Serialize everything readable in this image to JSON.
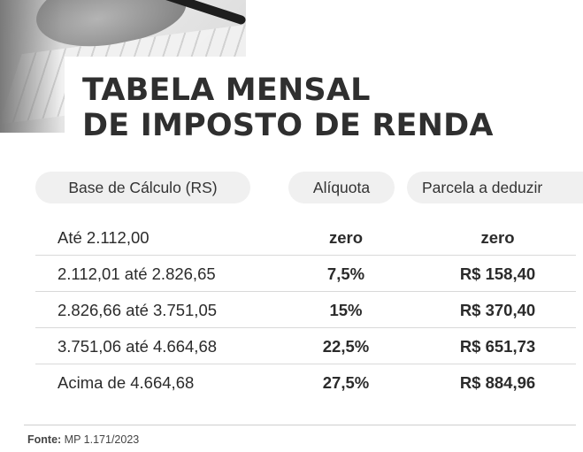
{
  "title": {
    "line1": "TABELA MENSAL",
    "line2": "DE IMPOSTO DE RENDA"
  },
  "table": {
    "headers": [
      "Base de Cálculo (RS)",
      "Alíquota",
      "Parcela a deduzir"
    ],
    "rows": [
      {
        "base": "Até 2.112,00",
        "aliquota": "zero",
        "parcela": "zero"
      },
      {
        "base": "2.112,01 até 2.826,65",
        "aliquota": "7,5%",
        "parcela": "R$ 158,40"
      },
      {
        "base": "2.826,66 até 3.751,05",
        "aliquota": "15%",
        "parcela": "R$ 370,40"
      },
      {
        "base": "3.751,06 até 4.664,68",
        "aliquota": "22,5%",
        "parcela": "R$ 651,73"
      },
      {
        "base": "Acima de 4.664,68",
        "aliquota": "27,5%",
        "parcela": "R$ 884,96"
      }
    ]
  },
  "footer": {
    "label": "Fonte:",
    "source": "MP 1.171/2023"
  }
}
